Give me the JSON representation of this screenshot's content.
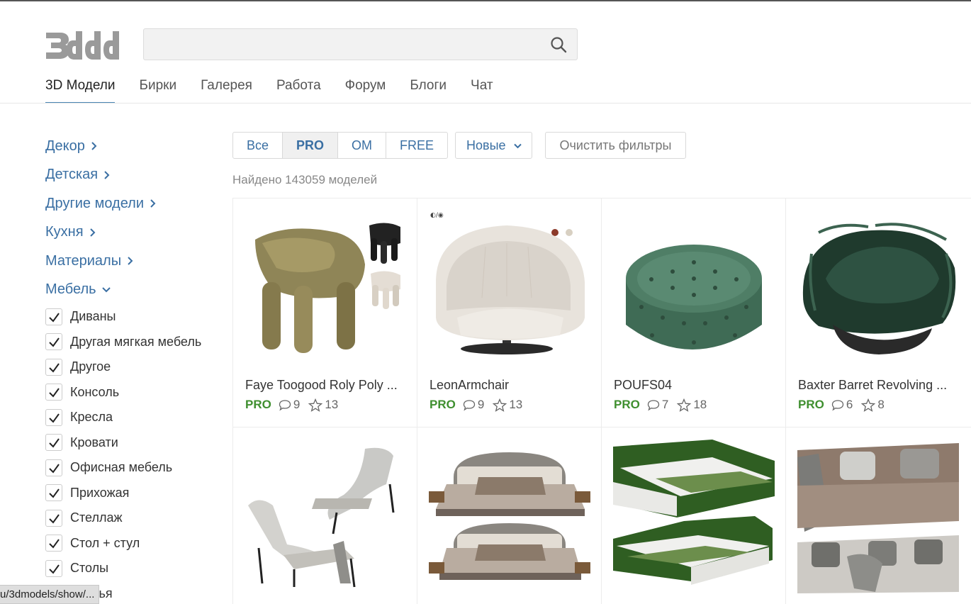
{
  "header": {
    "logo_text": "3ddd",
    "search_placeholder": "",
    "search_value": ""
  },
  "nav": [
    {
      "label": "3D Модели",
      "active": true
    },
    {
      "label": "Бирки"
    },
    {
      "label": "Галерея"
    },
    {
      "label": "Работа"
    },
    {
      "label": "Форум"
    },
    {
      "label": "Блоги"
    },
    {
      "label": "Чат"
    }
  ],
  "sidebar": {
    "categories": [
      {
        "label": "Декор",
        "icon": "chevron-right-icon"
      },
      {
        "label": "Детская",
        "icon": "chevron-right-icon"
      },
      {
        "label": "Другие модели",
        "icon": "chevron-right-icon"
      },
      {
        "label": "Кухня",
        "icon": "chevron-right-icon"
      },
      {
        "label": "Материалы",
        "icon": "chevron-right-icon"
      },
      {
        "label": "Мебель",
        "icon": "chevron-down-icon",
        "expanded": true
      }
    ],
    "subcategories": [
      {
        "label": "Диваны",
        "checked": true
      },
      {
        "label": "Другая мягкая мебель",
        "checked": true
      },
      {
        "label": "Другое",
        "checked": true
      },
      {
        "label": "Консоль",
        "checked": true
      },
      {
        "label": "Кресла",
        "checked": true
      },
      {
        "label": "Кровати",
        "checked": true
      },
      {
        "label": "Офисная мебель",
        "checked": true
      },
      {
        "label": "Прихожая",
        "checked": true
      },
      {
        "label": "Стеллаж",
        "checked": true
      },
      {
        "label": "Стол + стул",
        "checked": true
      },
      {
        "label": "Столы",
        "checked": true
      },
      {
        "label": "Стулья",
        "checked": true
      }
    ]
  },
  "filters": {
    "segments": [
      {
        "label": "Все"
      },
      {
        "label": "PRO",
        "active": true
      },
      {
        "label": "OM"
      },
      {
        "label": "FREE"
      }
    ],
    "sort_label": "Новые",
    "clear_label": "Очистить фильтры",
    "found_text": "Найдено 143059 моделей"
  },
  "models": [
    {
      "title": "Faye Toogood Roly Poly ...",
      "badge": "PRO",
      "comments": "9",
      "rating": "13"
    },
    {
      "title": "LeonArmchair",
      "badge": "PRO",
      "comments": "9",
      "rating": "13"
    },
    {
      "title": "POUFS04",
      "badge": "PRO",
      "comments": "7",
      "rating": "18"
    },
    {
      "title": "Baxter Barret Revolving ...",
      "badge": "PRO",
      "comments": "6",
      "rating": "8"
    },
    {
      "title": "",
      "badge": "",
      "comments": "",
      "rating": ""
    },
    {
      "title": "",
      "badge": "",
      "comments": "",
      "rating": ""
    },
    {
      "title": "",
      "badge": "",
      "comments": "",
      "rating": ""
    },
    {
      "title": "",
      "badge": "",
      "comments": "",
      "rating": ""
    }
  ],
  "status_url": "u/3dmodels/show/..."
}
